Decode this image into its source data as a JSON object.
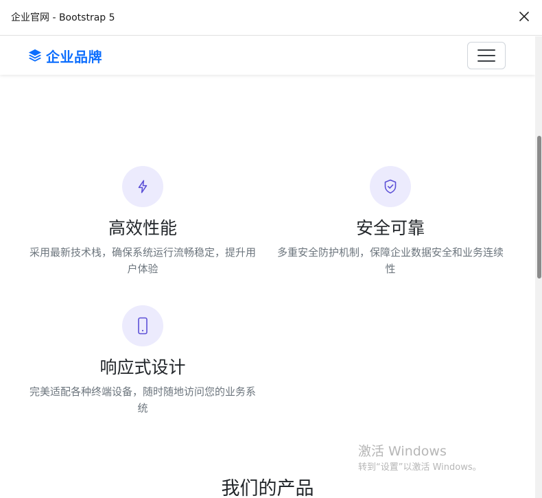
{
  "window": {
    "title": "企业官网 - Bootstrap 5"
  },
  "navbar": {
    "brand": "企业品牌",
    "brand_color": "#0d6efd"
  },
  "features": [
    {
      "icon": "lightning-icon",
      "title": "高效性能",
      "description": "采用最新技术栈，确保系统运行流畅稳定，提升用户体验"
    },
    {
      "icon": "shield-check-icon",
      "title": "安全可靠",
      "description": "多重安全防护机制，保障企业数据安全和业务连续性"
    },
    {
      "icon": "phone-icon",
      "title": "响应式设计",
      "description": "完美适配各种终端设备，随时随地访问您的业务系统"
    }
  ],
  "products": {
    "heading": "我们的产品"
  },
  "watermark": {
    "title": "激活 Windows",
    "subtitle": "转到“设置”以激活 Windows。"
  },
  "colors": {
    "accent": "#0d6efd",
    "icon_circle": "#ecebfd",
    "icon_stroke": "#5b4fd6",
    "muted_text": "#6c757d"
  }
}
